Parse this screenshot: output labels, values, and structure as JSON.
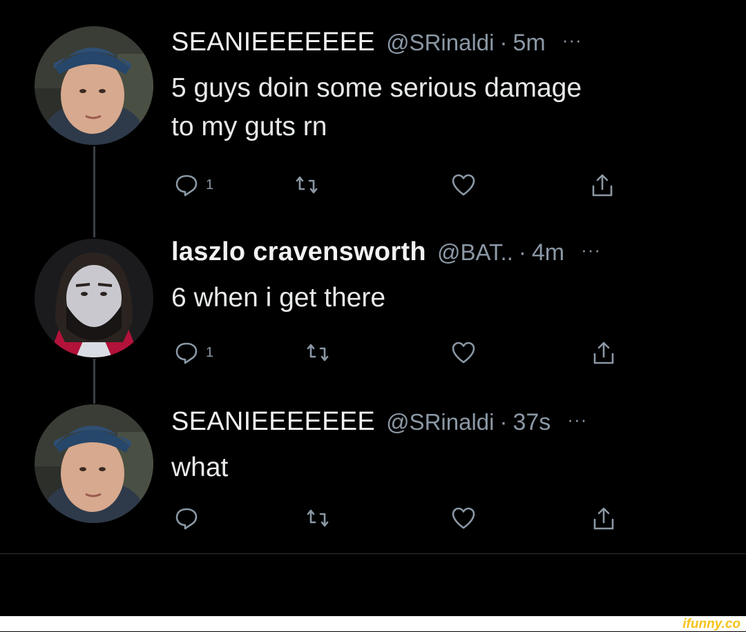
{
  "tweets": [
    {
      "name": "SEANIEEEEEEE",
      "handle": "@SRinaldi",
      "separator": "·",
      "time": "5m",
      "more": "···",
      "lines": [
        "5 guys doin some serious damage",
        "to my guts rn"
      ],
      "reply_count": "1"
    },
    {
      "name": "laszlo cravensworth",
      "handle": "@BAT..",
      "separator": "·",
      "time": "4m",
      "more": "···",
      "lines": [
        "6 when i get there"
      ],
      "reply_count": "1"
    },
    {
      "name": "SEANIEEEEEEE",
      "handle": "@SRinaldi",
      "separator": "·",
      "time": "37s",
      "more": "···",
      "lines": [
        "what"
      ],
      "reply_count": ""
    }
  ],
  "watermark": "ifunny.co",
  "icons": {
    "reply": "reply-icon",
    "retweet": "retweet-icon",
    "like": "heart-icon",
    "share": "share-icon",
    "more": "more-icon"
  },
  "colors": {
    "background": "#000000",
    "text": "#e7e9ea",
    "secondary": "#8b98a5",
    "thread_line": "#3b3f44",
    "watermark": "#f5c21b"
  }
}
